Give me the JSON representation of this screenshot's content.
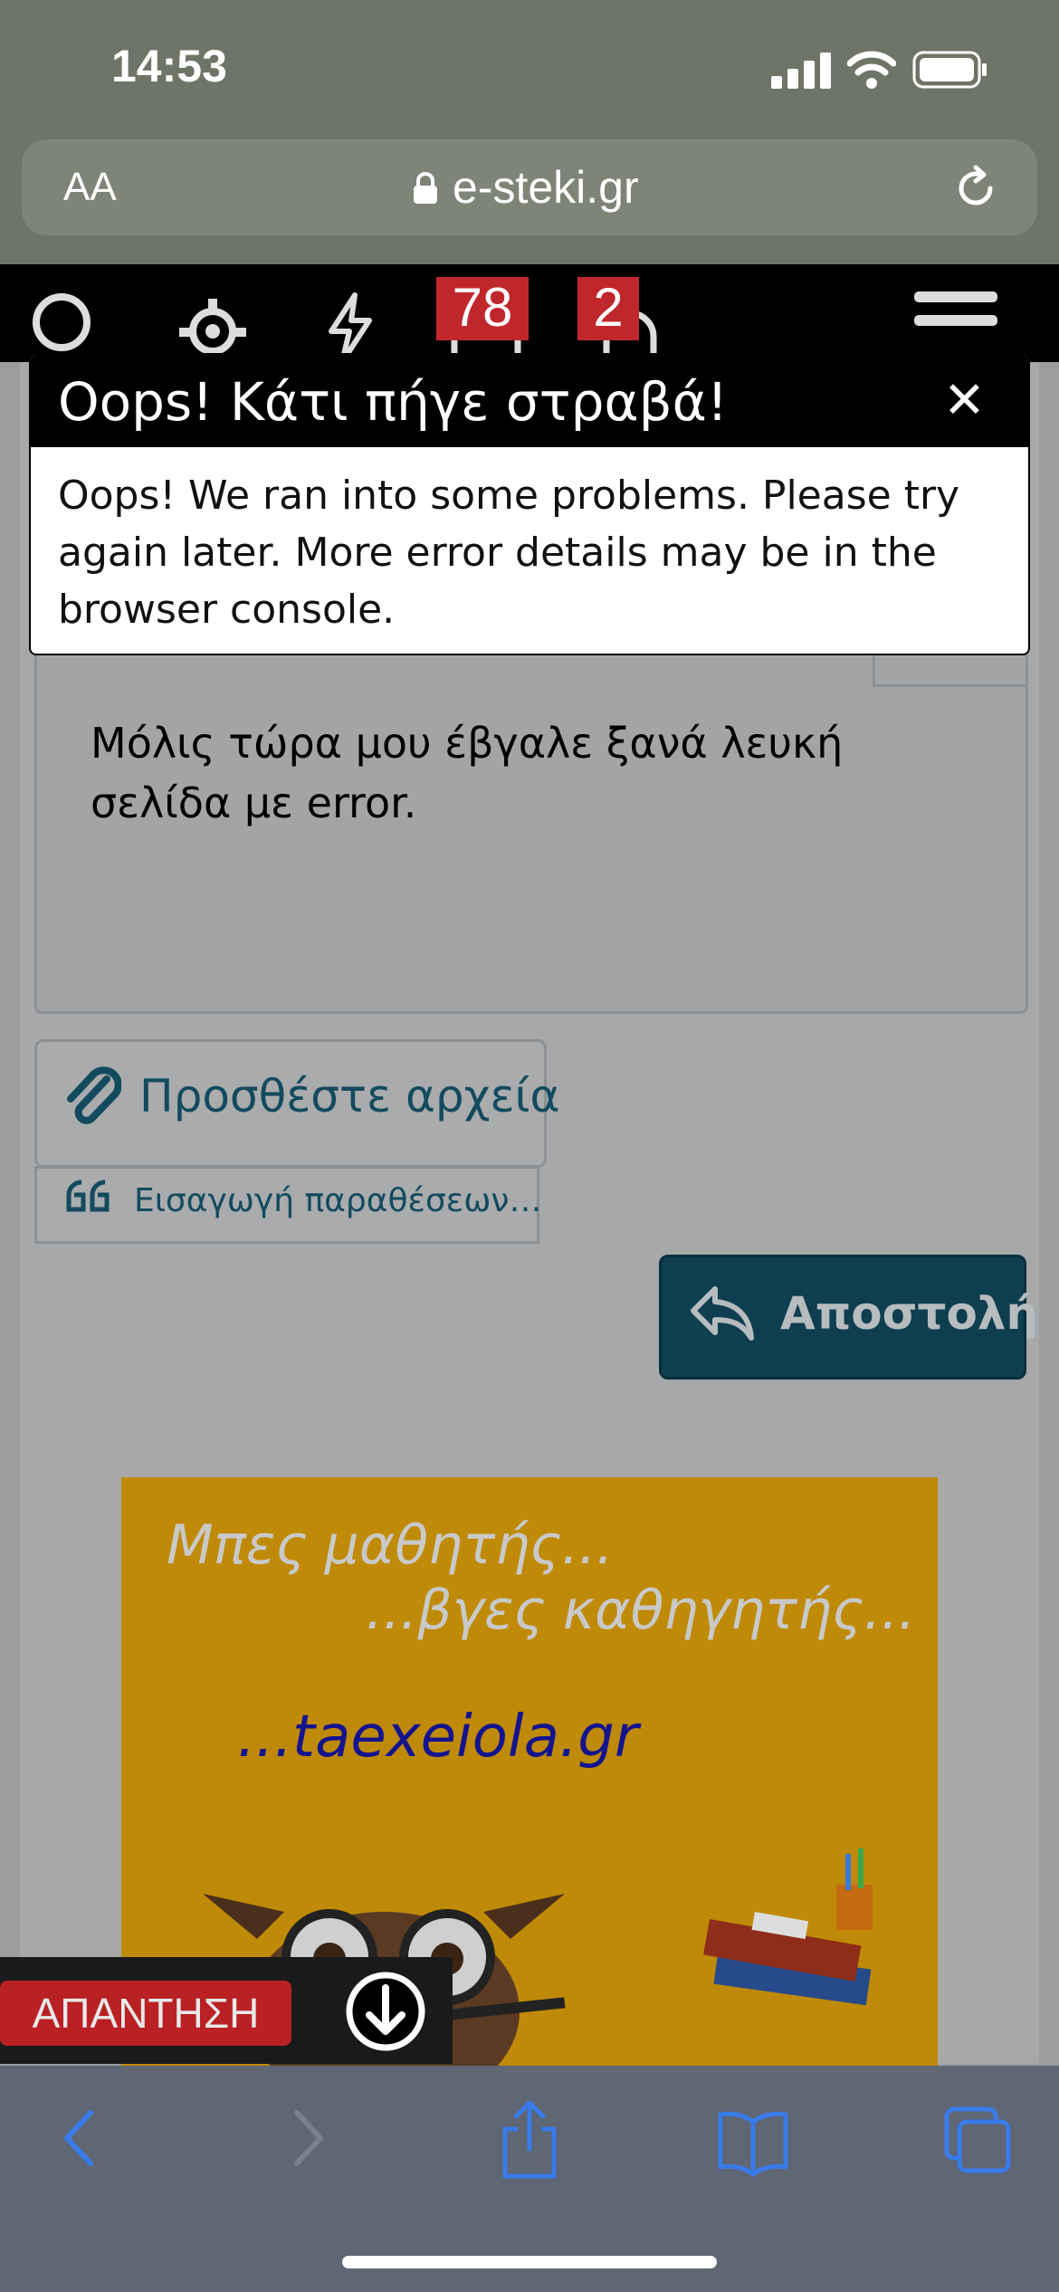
{
  "status_bar": {
    "time": "14:53"
  },
  "browser": {
    "text_size_label": "AA",
    "url": "e-steki.gr"
  },
  "header": {
    "badges": {
      "conversations": "78",
      "alerts": "2"
    }
  },
  "dialog": {
    "title": "Oops! Κάτι πήγε στραβά!",
    "close_symbol": "✕",
    "message": "Oops! We ran into some problems. Please try again later. More error details may be in the browser console."
  },
  "editor": {
    "text": "Μόλις τώρα μου έβγαλε ξανά λευκή σελίδα με error."
  },
  "actions": {
    "attach_label": "Προσθέστε αρχεία",
    "quote_label": "Εισαγωγή παραθέσεων…",
    "send_label": "Αποστολή"
  },
  "ad": {
    "line1": "Μπες μαθητής...",
    "line2": "...βγες καθηγητής...",
    "site": "...taexeiola.gr"
  },
  "reply_bar": {
    "reply_label": "ΑΠΑΝΤΗΣΗ"
  },
  "colors": {
    "accent": "#134a5e",
    "badge": "#c0272d",
    "ad_bg": "#bf8a07"
  }
}
